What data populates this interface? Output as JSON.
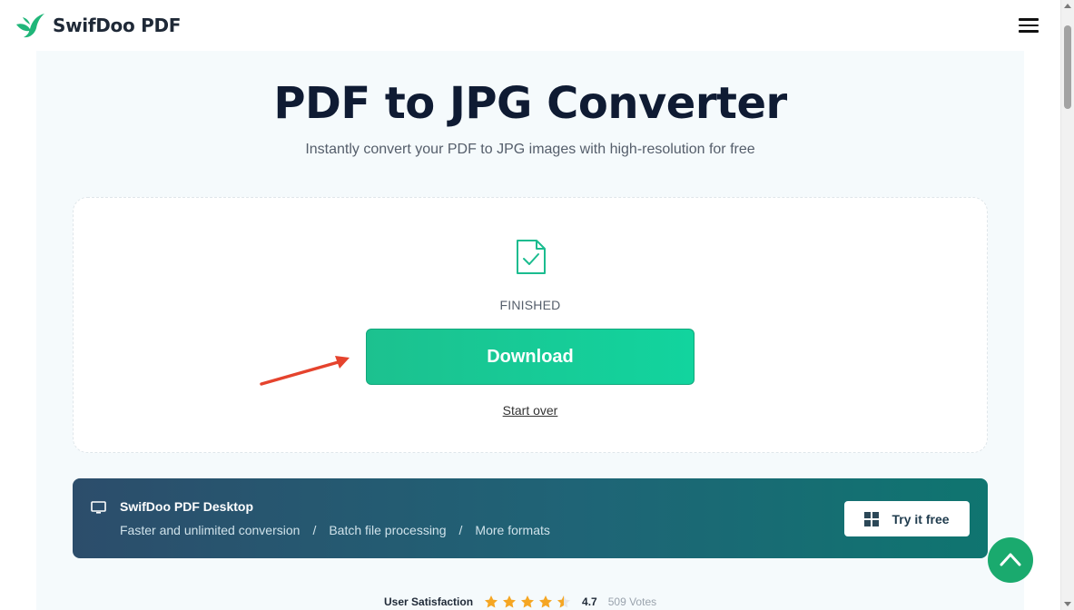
{
  "header": {
    "logo_text": "SwifDoo PDF",
    "menu_icon": "hamburger-menu-icon"
  },
  "hero": {
    "title": "PDF to JPG Converter",
    "subtitle": "Instantly convert your PDF to JPG images with high-resolution for free"
  },
  "result": {
    "status": "FINISHED",
    "download_label": "Download",
    "start_over_label": "Start over"
  },
  "promo": {
    "title": "SwifDoo PDF Desktop",
    "features": [
      "Faster and unlimited conversion",
      "Batch file processing",
      "More formats"
    ],
    "separator": "/",
    "cta_label": "Try it free"
  },
  "rating": {
    "label": "User Satisfaction",
    "score": "4.7",
    "votes": "509 Votes",
    "stars": 4.5
  },
  "colors": {
    "accent": "#12d49e",
    "title": "#0f1b33",
    "annotation_arrow": "#e5432d",
    "star": "#f5a623"
  }
}
